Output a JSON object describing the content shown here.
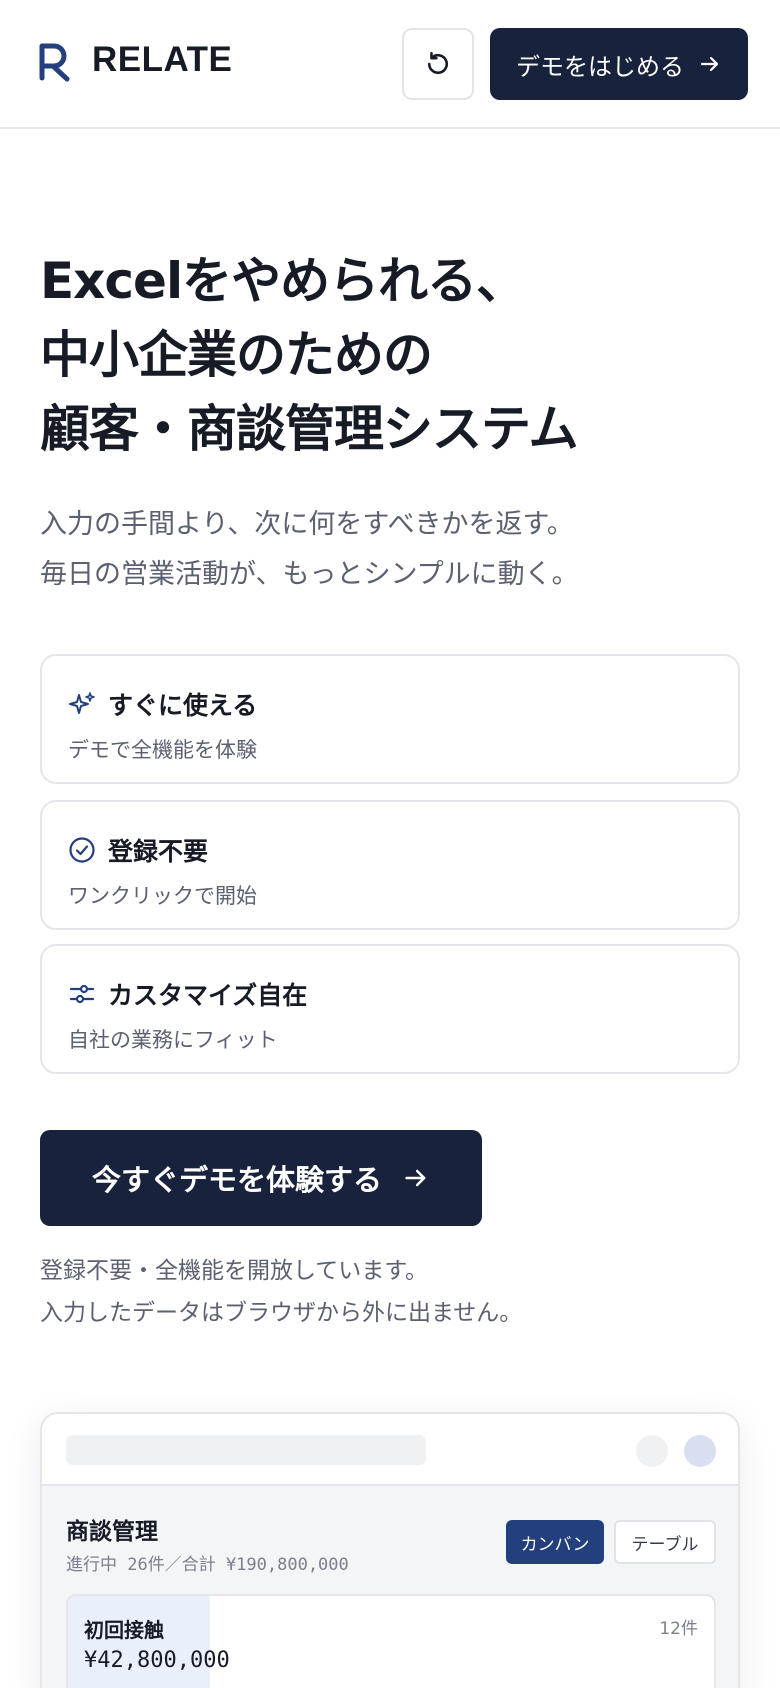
{
  "header": {
    "brand": "RELATE",
    "demo_button_label": "デモをはじめる",
    "colors": {
      "navy": "#19223d",
      "logo": "#233f7e"
    }
  },
  "hero": {
    "title_lines": [
      "Excelをやめられる、",
      "中小企業のための",
      "顧客・商談管理システム"
    ],
    "subtitle_lines": [
      "入力の手間より、次に何をすべきかを返す。",
      "毎日の営業活動が、もっとシンプルに動く。"
    ]
  },
  "features": [
    {
      "icon": "sparkles-icon",
      "title": "すぐに使える",
      "description": "デモで全機能を体験"
    },
    {
      "icon": "check-circle-icon",
      "title": "登録不要",
      "description": "ワンクリックで開始"
    },
    {
      "icon": "sliders-icon",
      "title": "カスタマイズ自在",
      "description": "自社の業務にフィット"
    }
  ],
  "cta": {
    "label": "今すぐデモを体験する",
    "note_lines": [
      "登録不要・全機能を開放しています。",
      "入力したデータはブラウザから外に出ません。"
    ]
  },
  "preview": {
    "title": "商談管理",
    "stats": "進行中 26件／合計 ¥190,800,000",
    "views": {
      "kanban": "カンバン",
      "table": "テーブル",
      "active": "kanban"
    },
    "stage": {
      "name": "初回接触",
      "amount": "¥42,800,000",
      "count": "12件",
      "share": 0.22
    }
  }
}
